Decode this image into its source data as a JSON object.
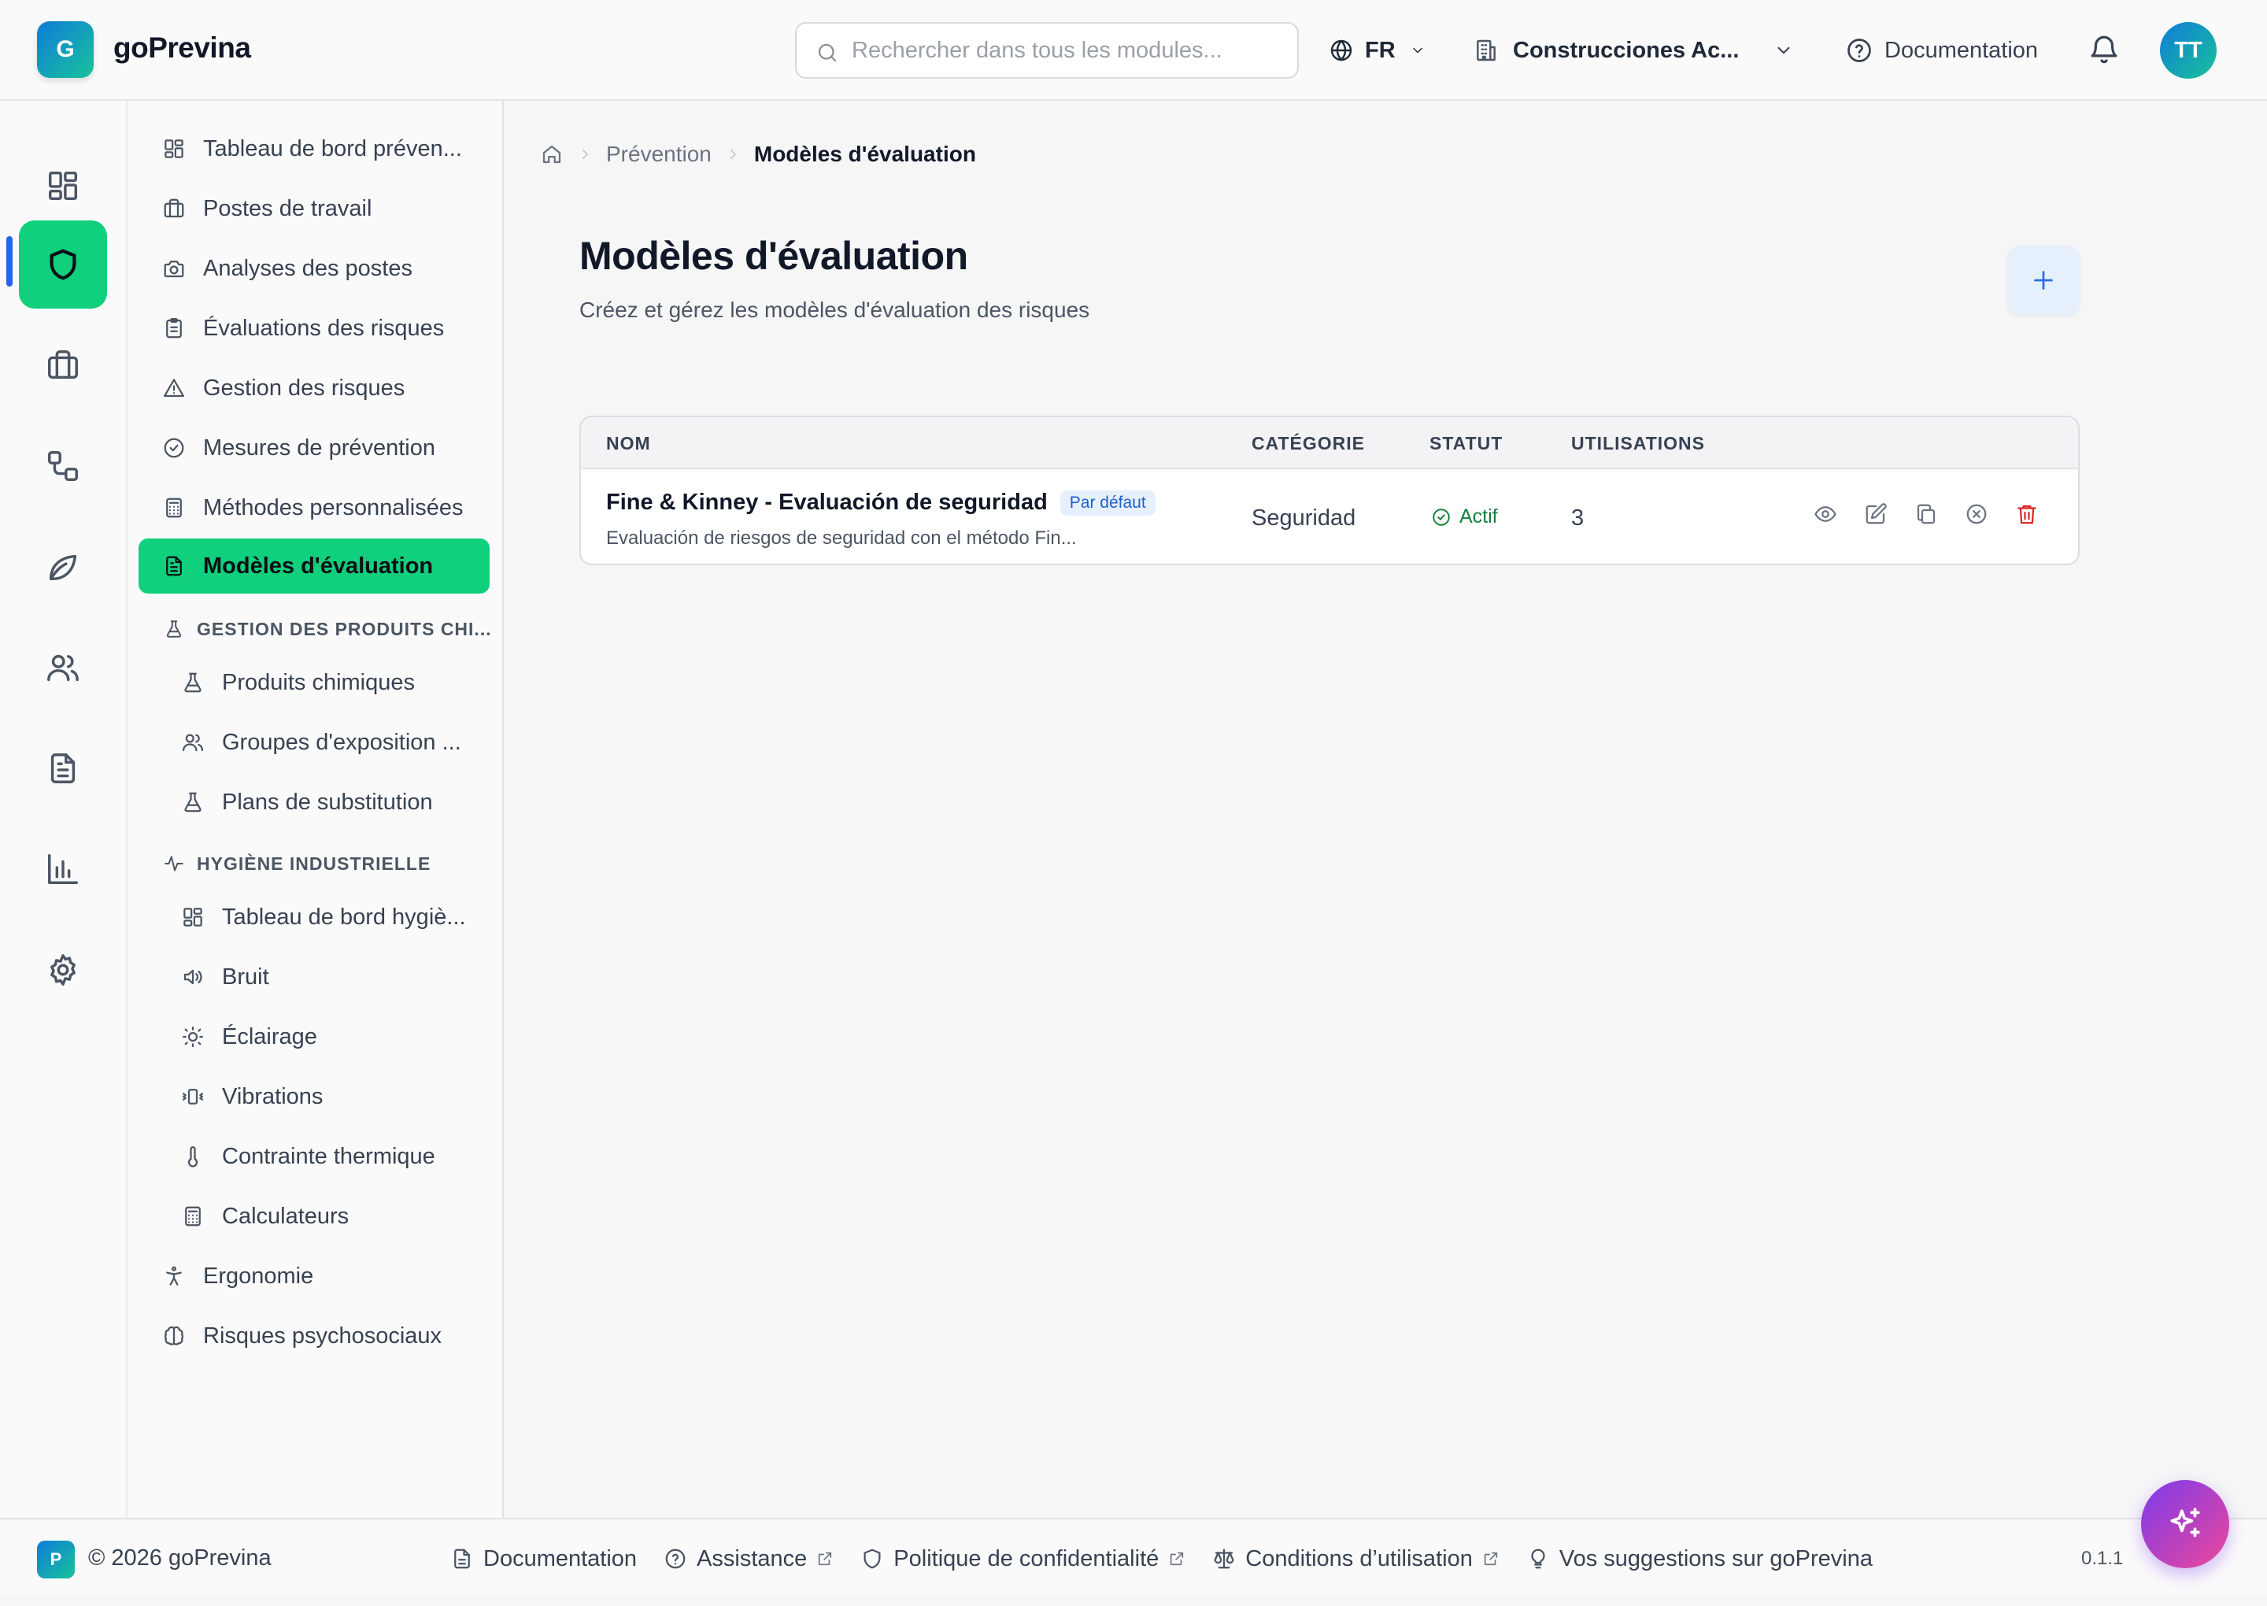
{
  "app": {
    "logo_letter": "G",
    "name": "goPrevina"
  },
  "search": {
    "placeholder": "Rechercher dans tous les modules..."
  },
  "language": {
    "code": "FR"
  },
  "organization": {
    "name": "Construcciones Ac..."
  },
  "header": {
    "documentation_label": "Documentation",
    "user_initials": "TT"
  },
  "rail": {
    "items": [
      "dashboard-icon",
      "shield-icon",
      "briefcase-icon",
      "workflow-icon",
      "leaf-icon",
      "users-icon",
      "file-text-icon",
      "bar-chart-icon",
      "gear-icon"
    ],
    "active": "shield-icon"
  },
  "sidebar": {
    "items": [
      {
        "label": "Tableau de bord préven...",
        "icon": "layout-dashboard-icon"
      },
      {
        "label": "Postes de travail",
        "icon": "briefcase-icon"
      },
      {
        "label": "Analyses des postes",
        "icon": "camera-icon"
      },
      {
        "label": "Évaluations des risques",
        "icon": "clipboard-icon"
      },
      {
        "label": "Gestion des risques",
        "icon": "warning-icon"
      },
      {
        "label": "Mesures de prévention",
        "icon": "check-circle-icon"
      },
      {
        "label": "Méthodes personnalisées",
        "icon": "calculator-icon"
      },
      {
        "label": "Modèles d'évaluation",
        "icon": "file-text-icon"
      }
    ],
    "chem_section": "GESTION DES PRODUITS CHI...",
    "chem_items": [
      {
        "label": "Produits chimiques",
        "icon": "flask-icon"
      },
      {
        "label": "Groupes d'exposition ...",
        "icon": "users-icon"
      },
      {
        "label": "Plans de substitution",
        "icon": "flask-icon"
      }
    ],
    "hyg_section": "HYGIÈNE INDUSTRIELLE",
    "hyg_items": [
      {
        "label": "Tableau de bord hygiè...",
        "icon": "layout-dashboard-icon"
      },
      {
        "label": "Bruit",
        "icon": "speaker-icon"
      },
      {
        "label": "Éclairage",
        "icon": "sun-icon"
      },
      {
        "label": "Vibrations",
        "icon": "vibrate-icon"
      },
      {
        "label": "Contrainte thermique",
        "icon": "thermometer-icon"
      },
      {
        "label": "Calculateurs",
        "icon": "calculator-icon"
      }
    ],
    "bottom_items": [
      {
        "label": "Ergonomie",
        "icon": "accessibility-icon"
      },
      {
        "label": "Risques psychosociaux",
        "icon": "brain-icon"
      }
    ]
  },
  "breadcrumb": {
    "parent": "Prévention",
    "current": "Modèles d'évaluation"
  },
  "page": {
    "title": "Modèles d'évaluation",
    "subtitle": "Créez et gérez les modèles d'évaluation des risques"
  },
  "table": {
    "columns": [
      "NOM",
      "CATÉGORIE",
      "STATUT",
      "UTILISATIONS"
    ],
    "rows": [
      {
        "name": "Fine & Kinney - Evaluación de seguridad",
        "badge": "Par défaut",
        "description": "Evaluación de riesgos de seguridad con el método Fin...",
        "category": "Seguridad",
        "status": "Actif",
        "uses": "3"
      }
    ]
  },
  "footer": {
    "logo_letter": "P",
    "copyright": "© 2026 goPrevina",
    "links": [
      "Documentation",
      "Assistance",
      "Politique de confidentialité",
      "Conditions d’utilisation",
      "Vos suggestions sur goPrevina"
    ],
    "version": "0.1.1"
  },
  "colors": {
    "accent": "#10cf7d",
    "primary": "#2563eb",
    "danger": "#dc2626",
    "success": "#15803d"
  }
}
